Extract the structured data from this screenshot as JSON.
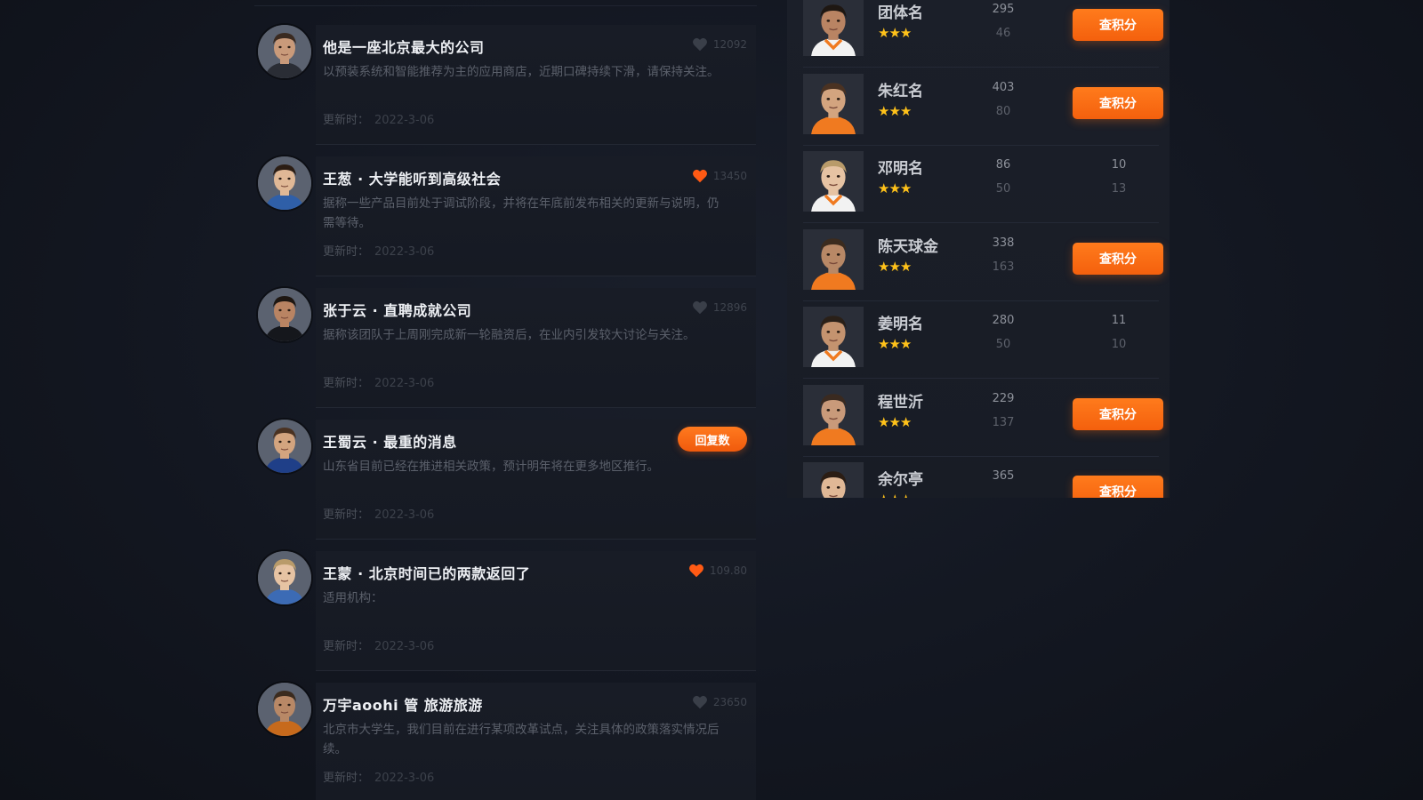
{
  "comments": [
    {
      "title": "他是一座北京最大的公司",
      "body": "以预装系统和智能推荐为主的应用商店，近期口碑持续下滑，请保持关注。",
      "meta_label": "更新时：",
      "date": "2022-3-06",
      "likes": "12092",
      "liked": false
    },
    {
      "title": "王葱 · 大学能听到高级社会",
      "body": "据称一些产品目前处于调试阶段，并将在年底前发布相关的更新与说明，仍需等待。",
      "meta_label": "更新时：",
      "date": "2022-3-06",
      "likes": "13450",
      "liked": true
    },
    {
      "title": "张于云 · 直聘成就公司",
      "body": "据称该团队于上周刚完成新一轮融资后，在业内引发较大讨论与关注。",
      "meta_label": "更新时：",
      "date": "2022-3-06",
      "likes": "12896",
      "liked": false
    },
    {
      "title": "王蜀云 · 最重的消息",
      "body": "山东省目前已经在推进相关政策，预计明年将在更多地区推行。",
      "meta_label": "更新时：",
      "date": "2022-3-06",
      "reply_label": "回复数",
      "liked": false
    },
    {
      "title": "王蒙 · 北京时间已的两款返回了",
      "body": "适用机构：",
      "meta_label": "更新时：",
      "date": "2022-3-06",
      "likes": "109.80",
      "liked": true
    },
    {
      "title": "万宇aoohi 管 旅游旅游",
      "body": "北京市大学生，我们目前在进行某项改革试点，关注具体的政策落实情况后续。",
      "meta_label": "更新时：",
      "date": "2022-3-06",
      "likes": "23650",
      "liked": false
    }
  ],
  "players": [
    {
      "name": "团体名",
      "stars": "★★★",
      "stat1": "295",
      "stat2": "46",
      "action": "查积分"
    },
    {
      "name": "朱红名",
      "stars": "★★★",
      "stat1": "403",
      "stat2": "80",
      "action": "查积分"
    },
    {
      "name": "邓明名",
      "stars": "★★★",
      "stat1": "86",
      "stat2": "50",
      "num1": "10",
      "num2": "13"
    },
    {
      "name": "陈天球金",
      "stars": "★★★",
      "stat1": "338",
      "stat2": "163",
      "action": "查积分"
    },
    {
      "name": "姜明名",
      "stars": "★★★",
      "stat1": "280",
      "stat2": "50",
      "num1": "11",
      "num2": "10"
    },
    {
      "name": "程世沂",
      "stars": "★★★",
      "stat1": "229",
      "stat2": "137",
      "action": "查积分"
    },
    {
      "name": "余尔亭",
      "stars": "★★★",
      "stat1": "365",
      "stat2": "",
      "action": "查积分"
    }
  ],
  "colors": {
    "accent": "#f4600d",
    "star": "#ffc21a",
    "heart_active": "#ff5a14"
  }
}
